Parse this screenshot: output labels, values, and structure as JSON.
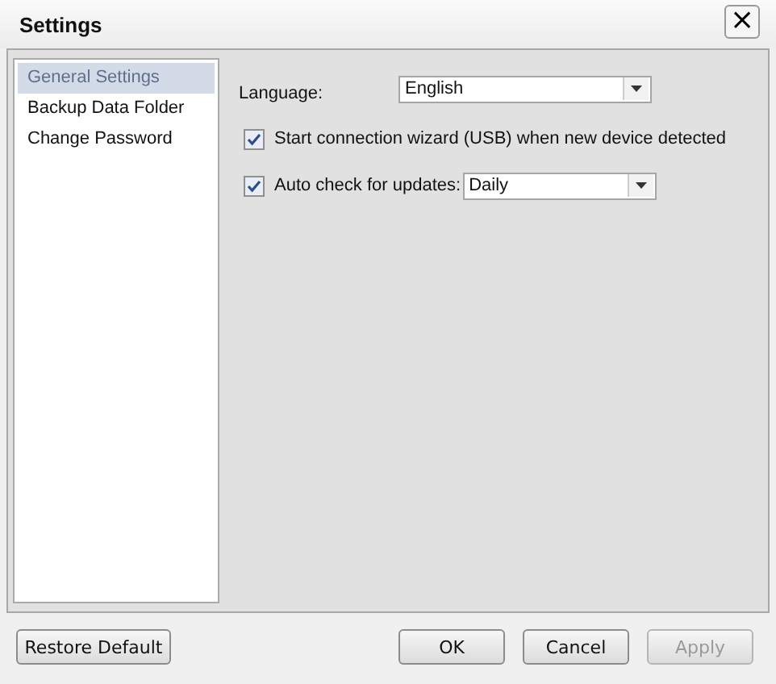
{
  "window": {
    "title": "Settings",
    "close": "×"
  },
  "sidebar": {
    "items": [
      {
        "label": "General Settings",
        "selected": true
      },
      {
        "label": "Backup Data Folder",
        "selected": false
      },
      {
        "label": "Change Password",
        "selected": false
      }
    ]
  },
  "language": {
    "label": "Language:",
    "value": "English"
  },
  "options": [
    {
      "kind": "checkbox",
      "label": "Start connection wizard (USB) when new device detected",
      "checked": true
    },
    {
      "kind": "checkbox_select",
      "label": "Auto check for updates:",
      "checked": true,
      "value": "Daily"
    }
  ],
  "buttons": [
    {
      "label": "Restore Default",
      "disabled": false
    },
    {
      "label": "OK",
      "disabled": false
    },
    {
      "label": "Cancel",
      "disabled": false
    },
    {
      "label": "Apply",
      "disabled": true
    }
  ]
}
